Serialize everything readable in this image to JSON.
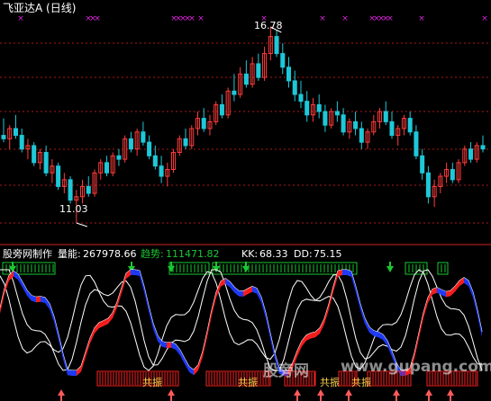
{
  "header": {
    "title": "飞亚达A (日线)",
    "high_label": "16.78",
    "low_label": "11.03"
  },
  "indicator": {
    "name": "股旁网制作",
    "volume_label": "量能:",
    "volume_value": "267978.66",
    "trend_label": "趋势:",
    "trend_value": "111471.82",
    "kk_label": "KK:",
    "kk_value": "68.33",
    "dd_label": "DD:",
    "dd_value": "75.15",
    "resonance_label": "共振"
  },
  "watermark": {
    "text_cn": "股旁网",
    "text_url": "www.gupang.com"
  },
  "colors": {
    "up": "#ff3b3b",
    "down": "#1fc8d8",
    "grid": "#b01818",
    "magenta_mark": "#e020e0",
    "green_signal": "#19c832",
    "blue_band": "#1f3cff",
    "red_band": "#ff2020"
  },
  "chart_data": {
    "type": "candlestick",
    "price_range": [
      11.03,
      16.78
    ],
    "high": 16.78,
    "low": 11.03,
    "candles": [
      [
        13.6,
        14.1,
        13.4,
        13.5
      ],
      [
        13.5,
        13.9,
        13.2,
        13.8
      ],
      [
        13.8,
        14.2,
        13.5,
        13.6
      ],
      [
        13.6,
        13.8,
        13.1,
        13.2
      ],
      [
        13.2,
        13.5,
        12.9,
        13.3
      ],
      [
        13.3,
        13.4,
        12.7,
        12.8
      ],
      [
        12.8,
        13.2,
        12.6,
        13.1
      ],
      [
        13.1,
        13.3,
        12.4,
        12.5
      ],
      [
        12.5,
        12.9,
        12.2,
        12.7
      ],
      [
        12.7,
        12.8,
        12.0,
        12.1
      ],
      [
        12.1,
        12.5,
        11.9,
        12.3
      ],
      [
        12.3,
        12.4,
        11.6,
        11.7
      ],
      [
        11.7,
        12.0,
        11.03,
        11.8
      ],
      [
        11.8,
        12.3,
        11.6,
        12.1
      ],
      [
        12.1,
        12.4,
        11.8,
        11.9
      ],
      [
        11.9,
        12.6,
        11.8,
        12.5
      ],
      [
        12.5,
        12.9,
        12.3,
        12.8
      ],
      [
        12.8,
        13.0,
        12.4,
        12.5
      ],
      [
        12.5,
        13.1,
        12.4,
        13.0
      ],
      [
        13.0,
        13.2,
        12.7,
        12.9
      ],
      [
        12.9,
        13.6,
        12.8,
        13.5
      ],
      [
        13.5,
        13.7,
        13.1,
        13.2
      ],
      [
        13.2,
        13.8,
        13.0,
        13.7
      ],
      [
        13.7,
        14.0,
        13.3,
        13.4
      ],
      [
        13.4,
        13.6,
        12.9,
        13.0
      ],
      [
        13.0,
        13.3,
        12.6,
        12.7
      ],
      [
        12.7,
        13.0,
        12.2,
        12.4
      ],
      [
        12.4,
        12.8,
        12.1,
        12.6
      ],
      [
        12.6,
        13.2,
        12.5,
        13.1
      ],
      [
        13.1,
        13.6,
        13.0,
        13.5
      ],
      [
        13.5,
        13.8,
        13.2,
        13.3
      ],
      [
        13.3,
        13.9,
        13.2,
        13.8
      ],
      [
        13.8,
        14.3,
        13.6,
        14.1
      ],
      [
        14.1,
        14.4,
        13.7,
        13.8
      ],
      [
        13.8,
        14.2,
        13.6,
        14.0
      ],
      [
        14.0,
        14.6,
        13.9,
        14.5
      ],
      [
        14.5,
        14.8,
        14.1,
        14.2
      ],
      [
        14.2,
        15.0,
        14.1,
        14.9
      ],
      [
        14.9,
        15.4,
        14.6,
        14.8
      ],
      [
        14.8,
        15.6,
        14.7,
        15.4
      ],
      [
        15.4,
        15.8,
        15.0,
        15.1
      ],
      [
        15.1,
        15.9,
        15.0,
        15.7
      ],
      [
        15.7,
        16.0,
        15.2,
        15.3
      ],
      [
        15.3,
        16.2,
        15.2,
        16.0
      ],
      [
        16.0,
        16.78,
        15.8,
        16.5
      ],
      [
        16.5,
        16.7,
        15.9,
        16.0
      ],
      [
        16.0,
        16.3,
        15.4,
        15.6
      ],
      [
        15.6,
        15.9,
        15.0,
        15.2
      ],
      [
        15.2,
        15.5,
        14.6,
        14.8
      ],
      [
        14.8,
        15.2,
        14.4,
        14.6
      ],
      [
        14.6,
        14.9,
        14.0,
        14.2
      ],
      [
        14.2,
        14.7,
        14.0,
        14.5
      ],
      [
        14.5,
        14.8,
        14.1,
        14.3
      ],
      [
        14.3,
        14.5,
        13.7,
        13.9
      ],
      [
        13.9,
        14.4,
        13.8,
        14.3
      ],
      [
        14.3,
        14.6,
        14.0,
        14.2
      ],
      [
        14.2,
        14.4,
        13.6,
        13.7
      ],
      [
        13.7,
        14.1,
        13.5,
        14.0
      ],
      [
        14.0,
        14.3,
        13.6,
        13.8
      ],
      [
        13.8,
        14.0,
        13.2,
        13.4
      ],
      [
        13.4,
        13.8,
        13.2,
        13.7
      ],
      [
        13.7,
        14.2,
        13.6,
        14.0
      ],
      [
        14.0,
        14.4,
        13.8,
        14.3
      ],
      [
        14.3,
        14.6,
        13.9,
        14.0
      ],
      [
        14.0,
        14.3,
        13.5,
        13.6
      ],
      [
        13.6,
        13.9,
        13.3,
        13.8
      ],
      [
        13.8,
        14.2,
        13.6,
        14.1
      ],
      [
        14.1,
        14.3,
        13.6,
        13.7
      ],
      [
        13.7,
        13.9,
        12.9,
        13.0
      ],
      [
        13.0,
        13.2,
        12.3,
        12.5
      ],
      [
        12.5,
        12.7,
        11.6,
        11.8
      ],
      [
        11.8,
        12.3,
        11.5,
        12.1
      ],
      [
        12.1,
        12.5,
        11.9,
        12.4
      ],
      [
        12.4,
        12.8,
        12.2,
        12.6
      ],
      [
        12.6,
        12.8,
        12.2,
        12.3
      ],
      [
        12.3,
        12.9,
        12.2,
        12.8
      ],
      [
        12.8,
        13.3,
        12.7,
        13.2
      ],
      [
        13.2,
        13.4,
        12.8,
        12.9
      ],
      [
        12.9,
        13.4,
        12.8,
        13.3
      ],
      [
        13.3,
        13.6,
        13.1,
        13.2
      ]
    ],
    "top_markers": [
      3,
      18,
      19,
      20,
      37,
      38,
      39,
      40,
      41,
      43,
      57,
      70,
      75,
      81,
      82,
      83,
      84,
      85,
      92,
      106
    ],
    "resonance_blocks": [
      [
        15,
        24
      ],
      [
        34,
        41
      ],
      [
        51,
        63
      ],
      [
        66,
        75
      ],
      [
        77,
        79
      ]
    ],
    "down_arrows": [
      3,
      21,
      28,
      35,
      40,
      62
    ],
    "up_arrows": [
      9,
      48,
      56,
      59,
      63,
      70,
      80
    ]
  }
}
